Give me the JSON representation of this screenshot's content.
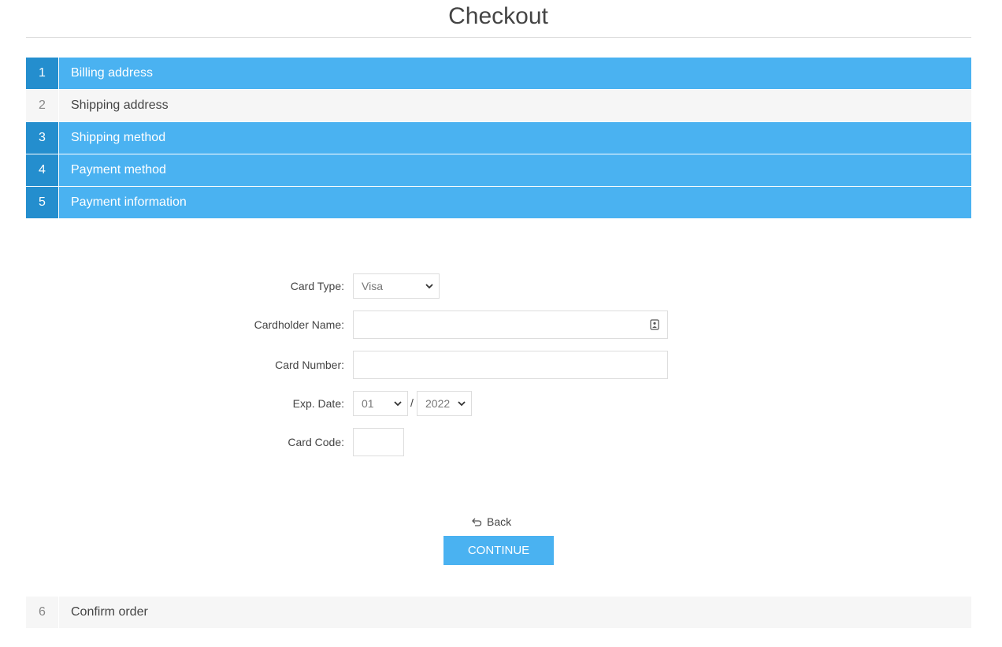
{
  "page": {
    "title": "Checkout"
  },
  "steps": [
    {
      "number": "1",
      "title": "Billing address",
      "state": "done"
    },
    {
      "number": "2",
      "title": "Shipping address",
      "state": "pending"
    },
    {
      "number": "3",
      "title": "Shipping method",
      "state": "done"
    },
    {
      "number": "4",
      "title": "Payment method",
      "state": "done"
    },
    {
      "number": "5",
      "title": "Payment information",
      "state": "done"
    }
  ],
  "form": {
    "card_type_label": "Card Type:",
    "card_type_value": "Visa",
    "cardholder_label": "Cardholder Name:",
    "cardholder_value": "",
    "card_number_label": "Card Number:",
    "card_number_value": "",
    "exp_date_label": "Exp. Date:",
    "exp_month_value": "01",
    "exp_separator": "/",
    "exp_year_value": "2022",
    "card_code_label": "Card Code:",
    "card_code_value": ""
  },
  "actions": {
    "back_label": "Back",
    "continue_label": "Continue"
  },
  "confirm_step": {
    "number": "6",
    "title": "Confirm order",
    "state": "pending"
  },
  "colors": {
    "accent": "#4ab2f1",
    "accent_dark": "#248ece",
    "pending_bg": "#f6f6f6"
  },
  "icons": {
    "back": "undo-arrow-icon",
    "autofill": "contact-card-icon",
    "dropdown": "chevron-down-icon"
  }
}
